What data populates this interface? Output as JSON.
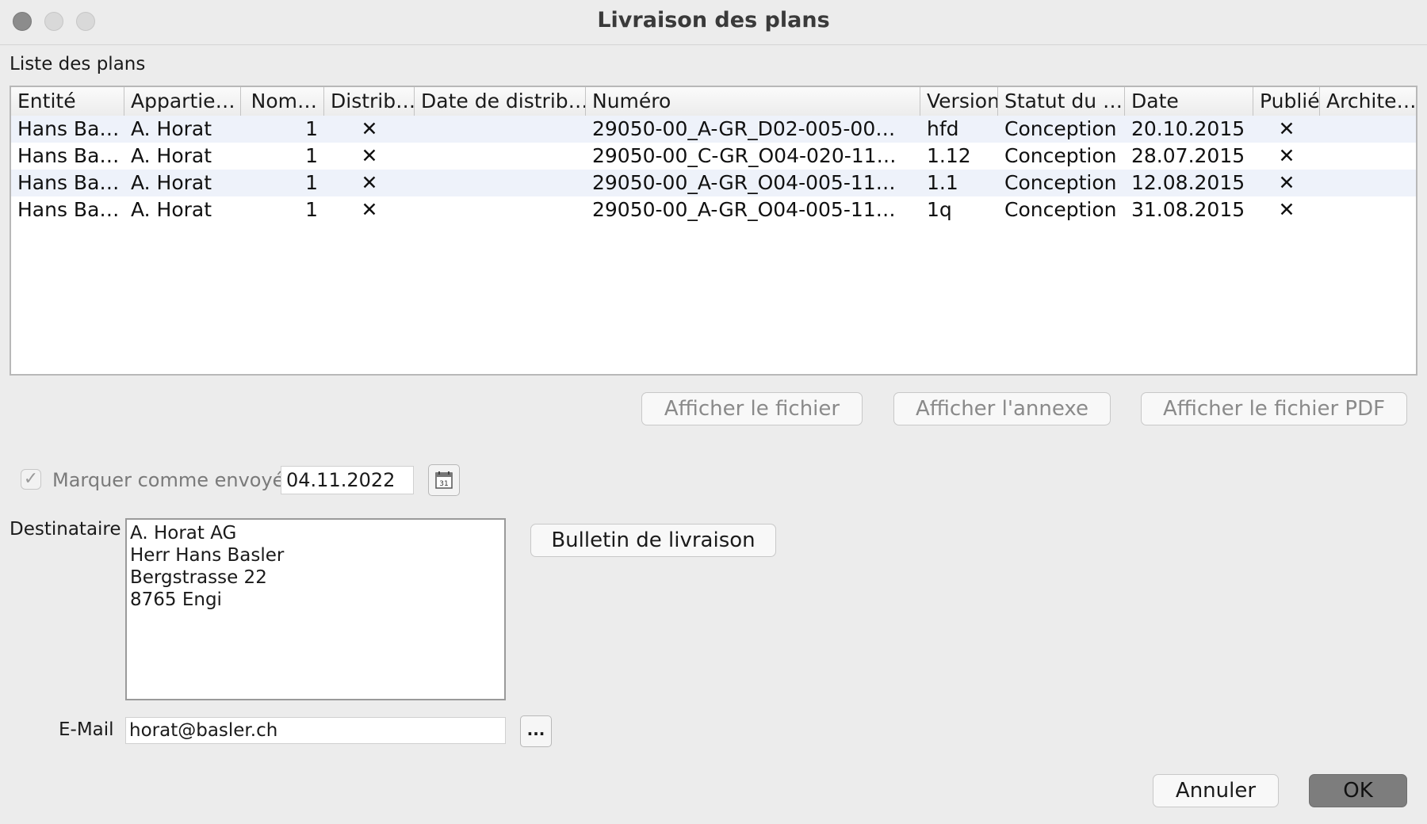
{
  "window": {
    "title": "Livraison des plans"
  },
  "table": {
    "section_label": "Liste des plans",
    "columns": [
      "Entité",
      "Appartie…",
      "Nom…",
      "Distrib…",
      "Date de distrib…",
      "Numéro",
      "Version",
      "Statut du …",
      "Date",
      "Publié",
      "Archite…"
    ],
    "rows": [
      {
        "entite": "Hans Ba…",
        "appartient": "A. Horat",
        "nombre": "1",
        "distrib": "✕",
        "date_distrib": "",
        "numero": "29050-00_A-GR_D02-005-00…",
        "version": "hfd",
        "statut": "Conception",
        "date": "20.10.2015",
        "publie": "✕",
        "architecte": ""
      },
      {
        "entite": "Hans Ba…",
        "appartient": "A. Horat",
        "nombre": "1",
        "distrib": "✕",
        "date_distrib": "",
        "numero": "29050-00_C-GR_O04-020-11…",
        "version": "1.12",
        "statut": "Conception",
        "date": "28.07.2015",
        "publie": "✕",
        "architecte": ""
      },
      {
        "entite": "Hans Ba…",
        "appartient": "A. Horat",
        "nombre": "1",
        "distrib": "✕",
        "date_distrib": "",
        "numero": "29050-00_A-GR_O04-005-11…",
        "version": "1.1",
        "statut": "Conception",
        "date": "12.08.2015",
        "publie": "✕",
        "architecte": ""
      },
      {
        "entite": "Hans Ba…",
        "appartient": "A. Horat",
        "nombre": "1",
        "distrib": "✕",
        "date_distrib": "",
        "numero": "29050-00_A-GR_O04-005-11…",
        "version": "1q",
        "statut": "Conception",
        "date": "31.08.2015",
        "publie": "✕",
        "architecte": ""
      }
    ]
  },
  "actions": {
    "show_file": "Afficher le fichier",
    "show_annex": "Afficher l'annexe",
    "show_pdf": "Afficher le fichier PDF"
  },
  "sent": {
    "checked": true,
    "label": "Marquer comme envoyé:",
    "date": "04.11.2022"
  },
  "recipient": {
    "label": "Destinataire",
    "address_lines": [
      "A. Horat AG",
      "Herr Hans Basler",
      "Bergstrasse 22",
      "8765 Engi"
    ],
    "delivery_note_button": "Bulletin de livraison"
  },
  "email": {
    "label": "E-Mail",
    "value": "horat@basler.ch",
    "more_button": "..."
  },
  "footer": {
    "cancel": "Annuler",
    "ok": "OK"
  }
}
